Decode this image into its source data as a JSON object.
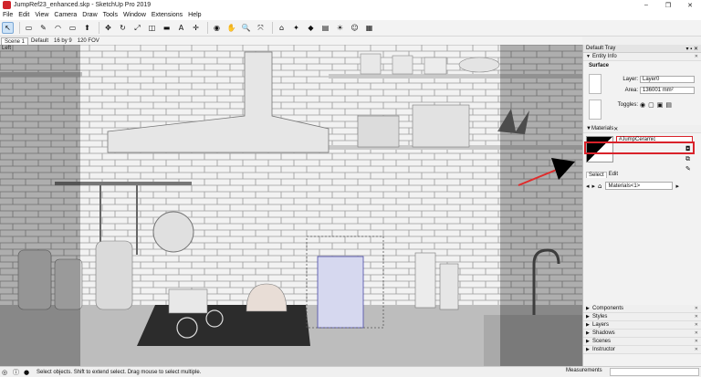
{
  "window": {
    "title": "JumpRef23_enhanced.skp - SketchUp Pro 2019",
    "controls": [
      "–",
      "❐",
      "✕"
    ]
  },
  "menu": [
    "File",
    "Edit",
    "View",
    "Camera",
    "Draw",
    "Tools",
    "Window",
    "Extensions",
    "Help"
  ],
  "toolbar": {
    "tools": [
      "select-icon",
      "eraser-icon",
      "pencil-icon",
      "arc-icon",
      "shape-icon",
      "pushpull-icon",
      "move-icon",
      "rotate-icon",
      "scale-icon",
      "offset-icon",
      "tape-icon",
      "text-icon",
      "axes-icon",
      "orbit-icon",
      "pan-icon",
      "zoom-icon",
      "zoom-extents-icon",
      "warehouse-icon",
      "extension-icon",
      "styles-icon",
      "layers-icon",
      "shadow-icon",
      "account-icon",
      "scenes-icon"
    ],
    "glyphs": [
      "↖",
      "▭",
      "✎",
      "◠",
      "▭",
      "⬆",
      "✥",
      "↻",
      "⤢",
      "◫",
      "▬",
      "A",
      "✛",
      "◉",
      "✋",
      "🔍",
      "⤧",
      "⌂",
      "✦",
      "◆",
      "▤",
      "☀",
      "☺",
      "▦"
    ]
  },
  "scenes": {
    "tabs": [
      "Scene 1",
      "Default",
      "16 by 9",
      "120 FOV"
    ],
    "active_index": 0
  },
  "viewport": {
    "label": "Left"
  },
  "tray": {
    "title": "Default Tray",
    "controls": "▾ ▪ ✕",
    "entity_info": {
      "header": "Entity Info",
      "type": "Surface",
      "layer_label": "Layer:",
      "layer_value": "Layer0",
      "area_label": "Area:",
      "area_value": "136001 mm²",
      "toggles_label": "Toggles:"
    },
    "materials": {
      "header": "Materials",
      "name": "#JumpCeramic",
      "tabs": [
        "Select",
        "Edit"
      ],
      "dropdown": "Materials<1>"
    },
    "collapsed_sections": [
      "Components",
      "Styles",
      "Layers",
      "Shadows",
      "Scenes",
      "Instructor"
    ]
  },
  "status": {
    "message": "Select objects. Shift to extend select. Drag mouse to select multiple.",
    "measurements_label": "Measurements"
  },
  "colors": {
    "highlight": "#d9222a",
    "accent_arrow": "#e02b2b"
  }
}
